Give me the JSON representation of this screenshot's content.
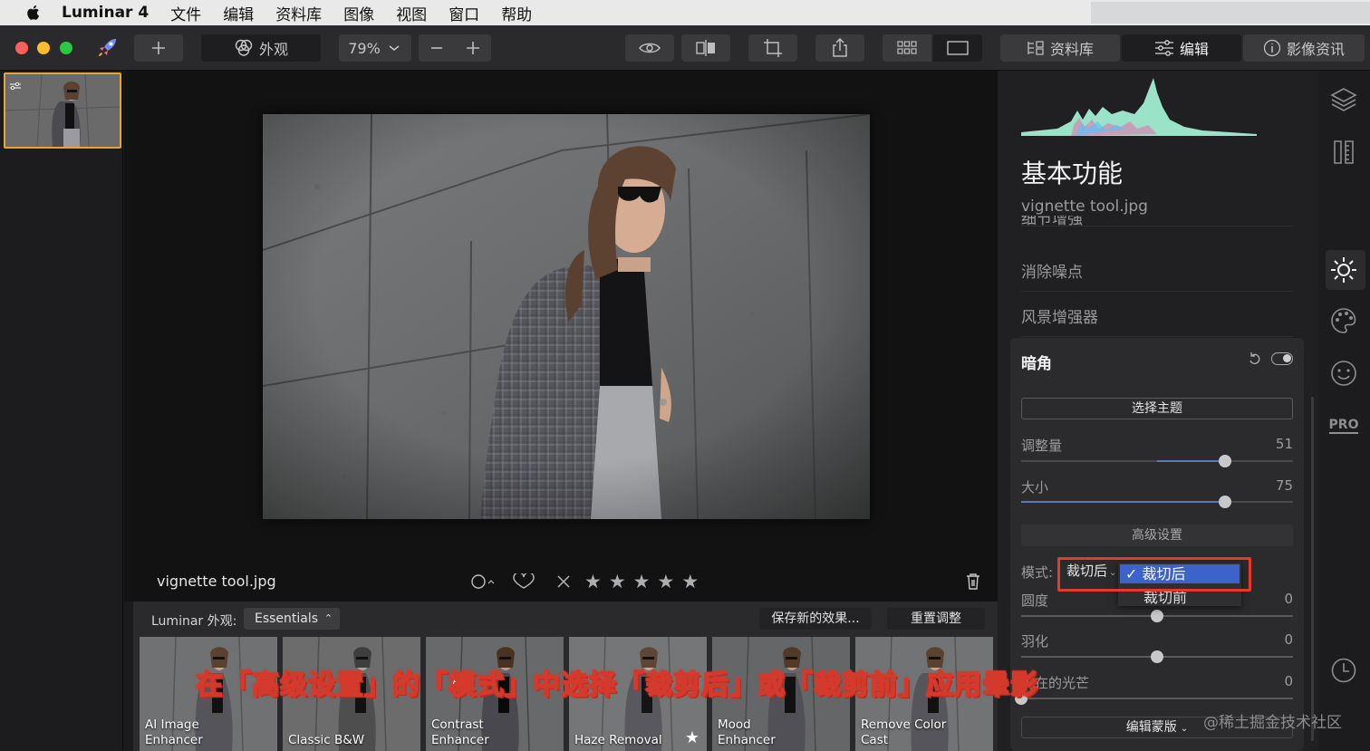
{
  "menubar": {
    "app_name": "Luminar 4",
    "items": [
      "文件",
      "编辑",
      "资料库",
      "图像",
      "视图",
      "窗口",
      "帮助"
    ]
  },
  "toolbar": {
    "looks_label": "外观",
    "zoom": "79%",
    "library_tab": "资料库",
    "edit_tab": "编辑",
    "info_tab": "影像资讯"
  },
  "image": {
    "filename": "vignette tool.jpg",
    "rating_stars": 5
  },
  "presets": {
    "label": "Luminar 外观:",
    "category": "Essentials",
    "save_button": "保存新的效果...",
    "reset_button": "重置调整",
    "tiles": [
      {
        "label": "AI Image\nEnhancer"
      },
      {
        "label": "Classic B&W"
      },
      {
        "label": "Contrast\nEnhancer"
      },
      {
        "label": "Haze Removal",
        "starred": true
      },
      {
        "label": "Mood\nEnhancer"
      },
      {
        "label": "Remove Color\nCast"
      }
    ]
  },
  "panel": {
    "title": "基本功能",
    "filename": "vignette tool.jpg",
    "tools": [
      "细节增强",
      "消除噪点",
      "风景增强器"
    ],
    "vignette": {
      "title": "暗角",
      "select_subject": "选择主题",
      "sliders": [
        {
          "label": "调整量",
          "value": 51,
          "fraction": 0.75
        },
        {
          "label": "大小",
          "value": 75,
          "fraction": 0.75
        }
      ],
      "advanced": "高级设置",
      "mode_label": "模式:",
      "mode_value": "裁切后",
      "mode_options": [
        "裁切后",
        "裁切前"
      ],
      "sliders2": [
        {
          "label": "圆度",
          "value": 0,
          "fraction": 0.5
        },
        {
          "label": "羽化",
          "value": 0,
          "fraction": 0.5
        },
        {
          "label": "内在的光芒",
          "value": 0,
          "fraction": 0.0
        }
      ],
      "edit_mask": "编辑蒙版"
    }
  },
  "caption": "在「高级设置」的「模式」中选择「裁剪后」或「裁剪前」应用晕影",
  "watermark": "@稀土掘金技术社区",
  "rail": {
    "pro_label": "PRO"
  }
}
